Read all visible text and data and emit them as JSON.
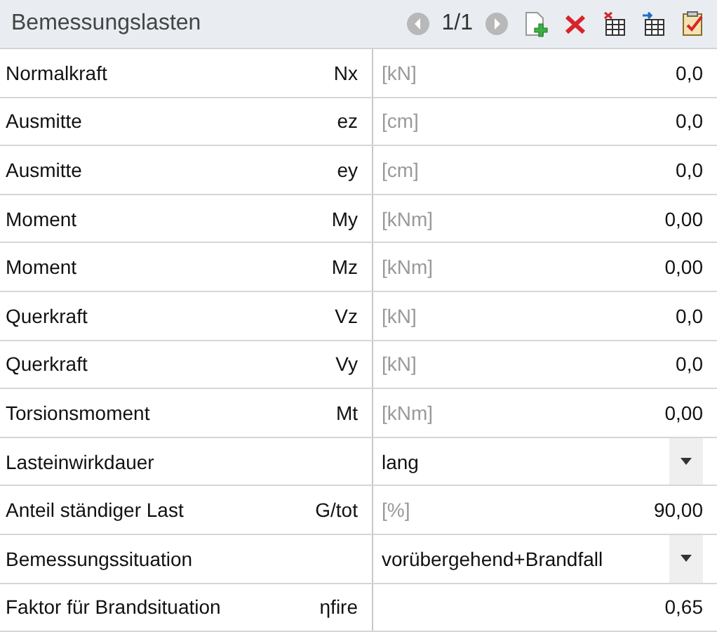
{
  "header": {
    "title": "Bemessungslasten",
    "page": "1/1"
  },
  "rows": [
    {
      "kind": "value",
      "label": "Normalkraft",
      "symbol": "Nx",
      "unit": "[kN]",
      "value": "0,0"
    },
    {
      "kind": "value",
      "label": "Ausmitte",
      "symbol": "ez",
      "unit": "[cm]",
      "value": "0,0"
    },
    {
      "kind": "value",
      "label": "Ausmitte",
      "symbol": "ey",
      "unit": "[cm]",
      "value": "0,0"
    },
    {
      "kind": "value",
      "label": "Moment",
      "symbol": "My",
      "unit": "[kNm]",
      "value": "0,00"
    },
    {
      "kind": "value",
      "label": "Moment",
      "symbol": "Mz",
      "unit": "[kNm]",
      "value": "0,00"
    },
    {
      "kind": "value",
      "label": "Querkraft",
      "symbol": "Vz",
      "unit": "[kN]",
      "value": "0,0"
    },
    {
      "kind": "value",
      "label": "Querkraft",
      "symbol": "Vy",
      "unit": "[kN]",
      "value": "0,0"
    },
    {
      "kind": "value",
      "label": "Torsionsmoment",
      "symbol": "Mt",
      "unit": "[kNm]",
      "value": "0,00"
    },
    {
      "kind": "dropdown",
      "label": "Lasteinwirkdauer",
      "value": "lang"
    },
    {
      "kind": "value",
      "label": "Anteil ständiger Last",
      "symbol": "G/tot",
      "unit": "[%]",
      "value": "90,00"
    },
    {
      "kind": "dropdown",
      "label": "Bemessungssituation",
      "value": "vorübergehend+Brandfall"
    },
    {
      "kind": "value",
      "label": "Faktor für Brandsituation",
      "symbol": "ηfire",
      "value": "0,65"
    }
  ]
}
